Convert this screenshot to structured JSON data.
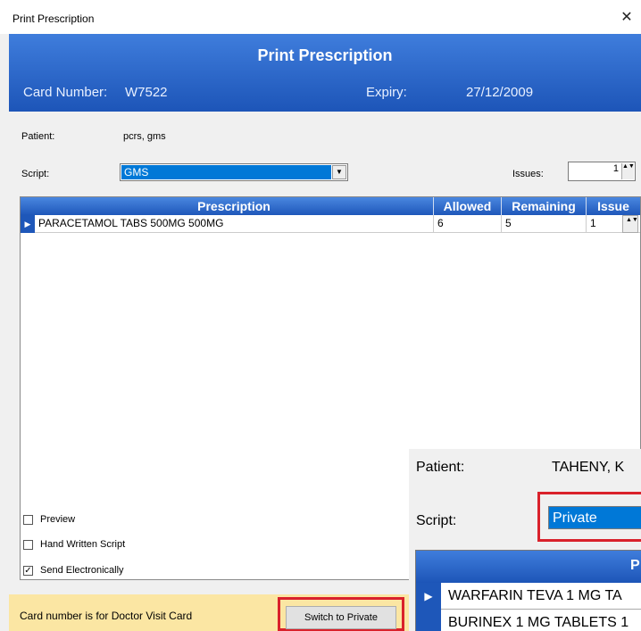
{
  "window": {
    "title": "Print Prescription",
    "close_glyph": "✕"
  },
  "banner": {
    "title": "Print Prescription",
    "card_label": "Card Number:",
    "card_value": "W7522",
    "expiry_label": "Expiry:",
    "expiry_value": "27/12/2009"
  },
  "patient": {
    "label": "Patient:",
    "value": "pcrs, gms"
  },
  "script": {
    "label": "Script:",
    "selected": "GMS",
    "arrow_glyph": "▼"
  },
  "issues": {
    "label": "Issues:",
    "value": "1",
    "spin_glyph": "▲▼"
  },
  "grid": {
    "headers": [
      "Prescription",
      "Allowed",
      "Remaining",
      "Issue"
    ],
    "rows": [
      {
        "selector": "▶",
        "prescription": "PARACETAMOL TABS 500MG 500MG",
        "allowed": "6",
        "remaining": "5",
        "issue": "1"
      }
    ]
  },
  "options": {
    "preview": {
      "label": "Preview",
      "checked": false,
      "mark": ""
    },
    "hand_written": {
      "label": "Hand Written Script",
      "checked": false,
      "mark": ""
    },
    "send_electronically": {
      "label": "Send Electronically",
      "checked": true,
      "mark": "✓"
    }
  },
  "footer": {
    "message": "Card number is for Doctor Visit Card",
    "switch_button": "Switch to Private"
  },
  "zoom_inset": {
    "patient_label": "Patient:",
    "patient_value": "TAHENY, K",
    "script_label": "Script:",
    "script_selected": "Private",
    "header_partial": "P",
    "rows": [
      "WARFARIN TEVA 1 MG TA",
      "BURINEX 1 MG TABLETS 1"
    ],
    "row_selector": "▶"
  },
  "colors": {
    "header_blue": "#1d55b8",
    "selection_blue": "#0078d7",
    "highlight_red": "#d9212b",
    "footer_yellow": "#fbe6a3"
  }
}
